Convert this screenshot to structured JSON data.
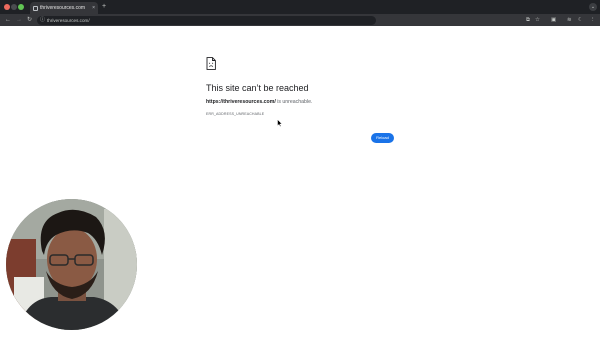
{
  "browser": {
    "tab_title": "thriveresources.com",
    "new_tab_symbol": "+",
    "tab_close_symbol": "×",
    "url": "thriveresources.com/",
    "menu_symbol": "⌄"
  },
  "error_page": {
    "title": "This site can’t be reached",
    "host": "https://thriveresources.com/",
    "message_suffix": " is unreachable.",
    "error_code": "ERR_ADDRESS_UNREACHABLE",
    "reload_label": "Reload"
  },
  "icons": {
    "back": "back-arrow-icon",
    "forward": "forward-arrow-icon",
    "reload": "reload-icon",
    "site_info": "site-info-icon",
    "bookmark": "bookmark-star-icon",
    "extensions": "extensions-icon",
    "sad_document": "sad-document-icon",
    "cursor": "mouse-cursor-icon"
  },
  "colors": {
    "titlebar": "#1f2125",
    "toolbar": "#35363a",
    "reload_button": "#1a73e8",
    "title_text": "#202124",
    "secondary_text": "#5f6368"
  }
}
